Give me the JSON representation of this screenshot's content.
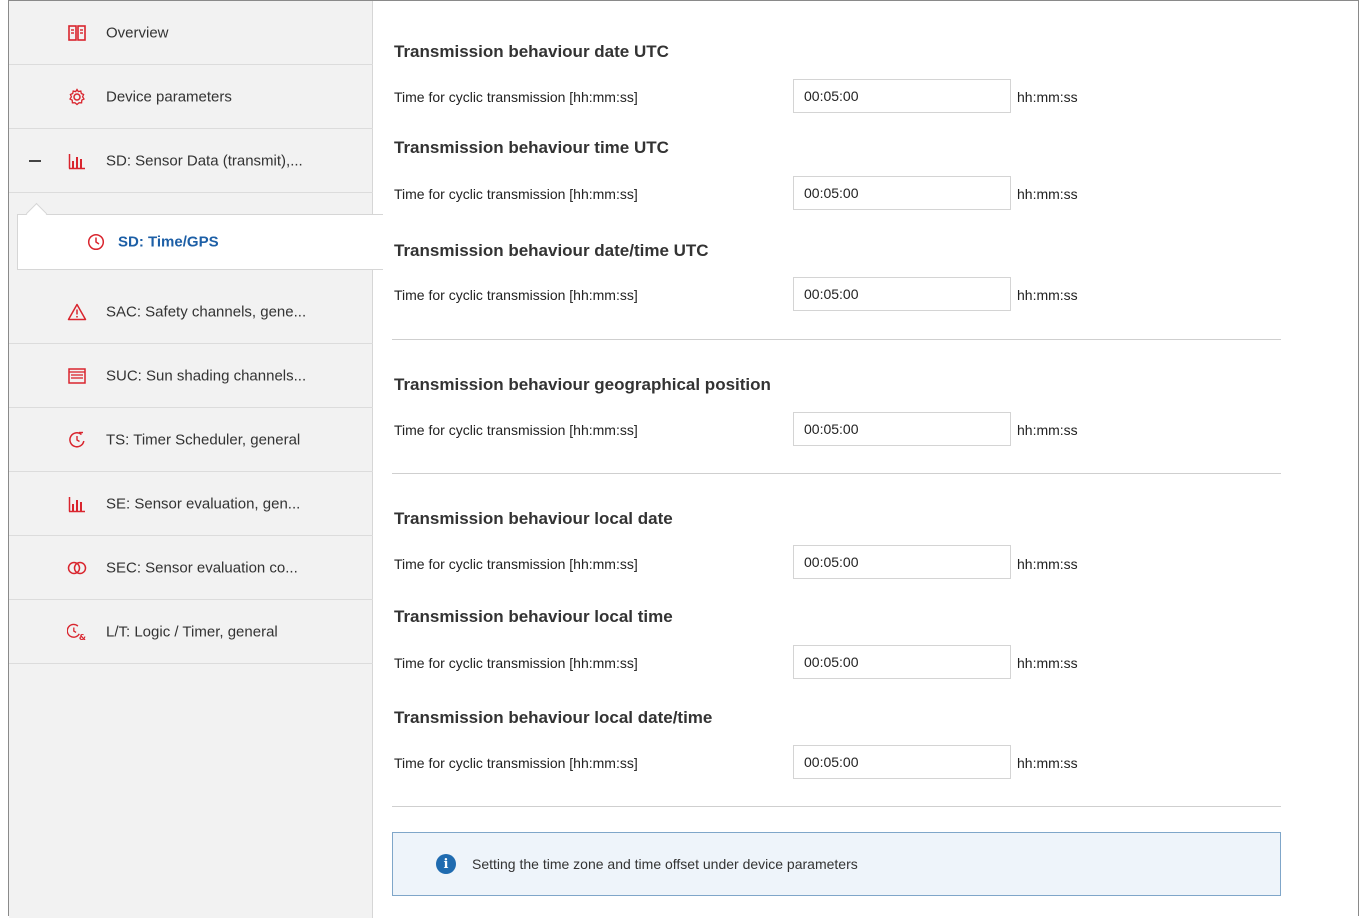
{
  "sidebar": {
    "items": [
      {
        "label": "Overview",
        "icon": "book-icon"
      },
      {
        "label": "Device parameters",
        "icon": "gear-icon"
      },
      {
        "label": "SD: Sensor Data (transmit),...",
        "icon": "bar-chart-icon"
      },
      {
        "label": "SD: Time/GPS",
        "icon": "clock-icon"
      },
      {
        "label": "SAC: Safety channels, gene...",
        "icon": "warning-icon"
      },
      {
        "label": "SUC: Sun shading channels...",
        "icon": "blind-icon"
      },
      {
        "label": "TS: Timer Scheduler, general",
        "icon": "timer-icon"
      },
      {
        "label": "SE: Sensor evaluation, gen...",
        "icon": "bar-chart-icon"
      },
      {
        "label": "SEC: Sensor evaluation co...",
        "icon": "linked-rings-icon"
      },
      {
        "label": "L/T: Logic / Timer, general",
        "icon": "logic-timer-icon"
      }
    ],
    "active_index": 3,
    "accent_color": "#d9252e"
  },
  "main": {
    "sections": [
      {
        "title": "Transmission behaviour date UTC",
        "label": "Time for cyclic transmission [hh:mm:ss]",
        "value": "00:05:00",
        "unit": "hh:mm:ss"
      },
      {
        "title": "Transmission behaviour time UTC",
        "label": "Time for cyclic transmission [hh:mm:ss]",
        "value": "00:05:00",
        "unit": "hh:mm:ss"
      },
      {
        "title": "Transmission behaviour date/time UTC",
        "label": "Time for cyclic transmission [hh:mm:ss]",
        "value": "00:05:00",
        "unit": "hh:mm:ss"
      },
      {
        "title": "Transmission behaviour geographical position",
        "label": "Time for cyclic transmission [hh:mm:ss]",
        "value": "00:05:00",
        "unit": "hh:mm:ss"
      },
      {
        "title": "Transmission behaviour local date",
        "label": "Time for cyclic transmission [hh:mm:ss]",
        "value": "00:05:00",
        "unit": "hh:mm:ss"
      },
      {
        "title": "Transmission behaviour local time",
        "label": "Time for cyclic transmission [hh:mm:ss]",
        "value": "00:05:00",
        "unit": "hh:mm:ss"
      },
      {
        "title": "Transmission behaviour local date/time",
        "label": "Time for cyclic transmission [hh:mm:ss]",
        "value": "00:05:00",
        "unit": "hh:mm:ss"
      }
    ],
    "info": {
      "text": "Setting the time zone and time offset under device parameters",
      "icon": "info-icon",
      "text_icon": "i"
    }
  }
}
